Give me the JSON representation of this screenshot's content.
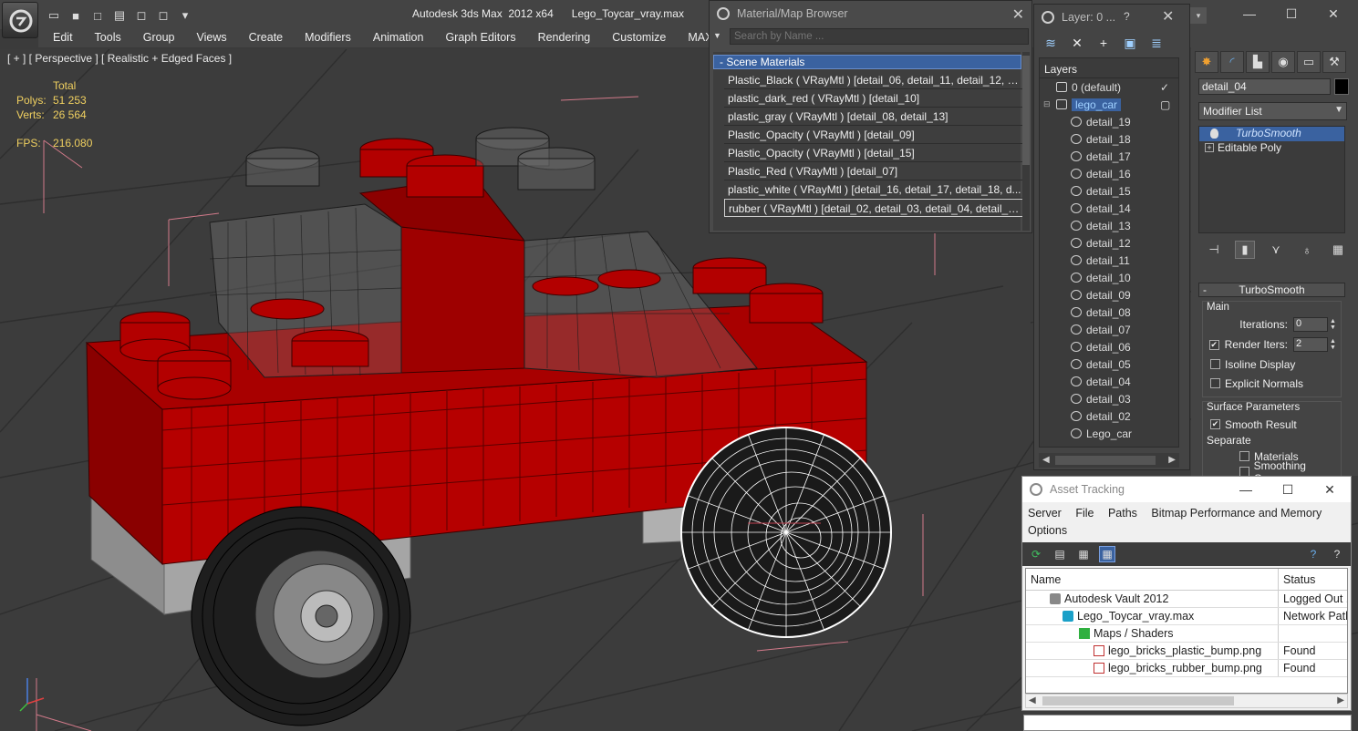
{
  "app": {
    "title": "Autodesk 3ds Max  2012 x64      Lego_Toycar_vray.max"
  },
  "menu": [
    "Edit",
    "Tools",
    "Group",
    "Views",
    "Create",
    "Modifiers",
    "Animation",
    "Graph Editors",
    "Rendering",
    "Customize",
    "MAXScript"
  ],
  "viewport": {
    "label": "[ + ] [ Perspective ] [ Realistic + Edged Faces ]",
    "stats_total": "Total",
    "polys_label": "Polys:",
    "polys_value": "51 253",
    "verts_label": "Verts:",
    "verts_value": "26 564",
    "fps_label": "FPS:",
    "fps_value": "216.080"
  },
  "material_browser": {
    "title": "Material/Map Browser",
    "search_placeholder": "Search by Name ...",
    "group": "- Scene Materials",
    "items": [
      "Plastic_Black  ( VRayMtl )  [detail_06, detail_11, detail_12, d...",
      "plastic_dark_red  ( VRayMtl )  [detail_10]",
      "plastic_gray  ( VRayMtl )  [detail_08, detail_13]",
      "Plastic_Opacity  ( VRayMtl )  [detail_09]",
      "Plastic_Opacity  ( VRayMtl )  [detail_15]",
      "Plastic_Red  ( VRayMtl )  [detail_07]",
      "plastic_white  ( VRayMtl )  [detail_16, detail_17, detail_18, d...",
      "rubber  ( VRayMtl )  [detail_02, detail_03, detail_04, detail_0..."
    ]
  },
  "layer_panel": {
    "title": "Layer: 0 ...",
    "help": "?",
    "header": "Layers",
    "default_layer": "0 (default)",
    "active_layer": "lego_car",
    "children": [
      "detail_19",
      "detail_18",
      "detail_17",
      "detail_16",
      "detail_15",
      "detail_14",
      "detail_13",
      "detail_12",
      "detail_11",
      "detail_10",
      "detail_09",
      "detail_08",
      "detail_07",
      "detail_06",
      "detail_05",
      "detail_04",
      "detail_03",
      "detail_02",
      "Lego_car"
    ]
  },
  "command_panel": {
    "object_name": "detail_04",
    "modifier_list": "Modifier List",
    "stack": [
      "TurboSmooth",
      "Editable Poly"
    ],
    "rollout_title": "TurboSmooth",
    "main_label": "Main",
    "iterations_label": "Iterations:",
    "iterations_value": "0",
    "render_iters_label": "Render Iters:",
    "render_iters_value": "2",
    "render_iters_checked": "✔",
    "isoline_label": "Isoline Display",
    "explicit_normals_label": "Explicit Normals",
    "surface_params_label": "Surface Parameters",
    "smooth_result_label": "Smooth Result",
    "smooth_result_checked": "✔",
    "separate_label": "Separate",
    "materials_label": "Materials",
    "smoothing_groups_label": "Smoothing Groups"
  },
  "asset_tracking": {
    "title": "Asset Tracking",
    "menu": [
      "Server",
      "File",
      "Paths",
      "Bitmap Performance and Memory"
    ],
    "menu2": "Options",
    "col_name": "Name",
    "col_status": "Status",
    "rows": [
      {
        "name": "Autodesk Vault 2012",
        "status": "Logged Out ..."
      },
      {
        "name": "Lego_Toycar_vray.max",
        "status": "Network Path"
      },
      {
        "name": "Maps / Shaders",
        "status": ""
      },
      {
        "name": "lego_bricks_plastic_bump.png",
        "status": "Found"
      },
      {
        "name": "lego_bricks_rubber_bump.png",
        "status": "Found"
      }
    ]
  },
  "colors": {
    "accent": "#3a62a0",
    "stats": "#f0d060",
    "lego_red": "#b00000"
  }
}
